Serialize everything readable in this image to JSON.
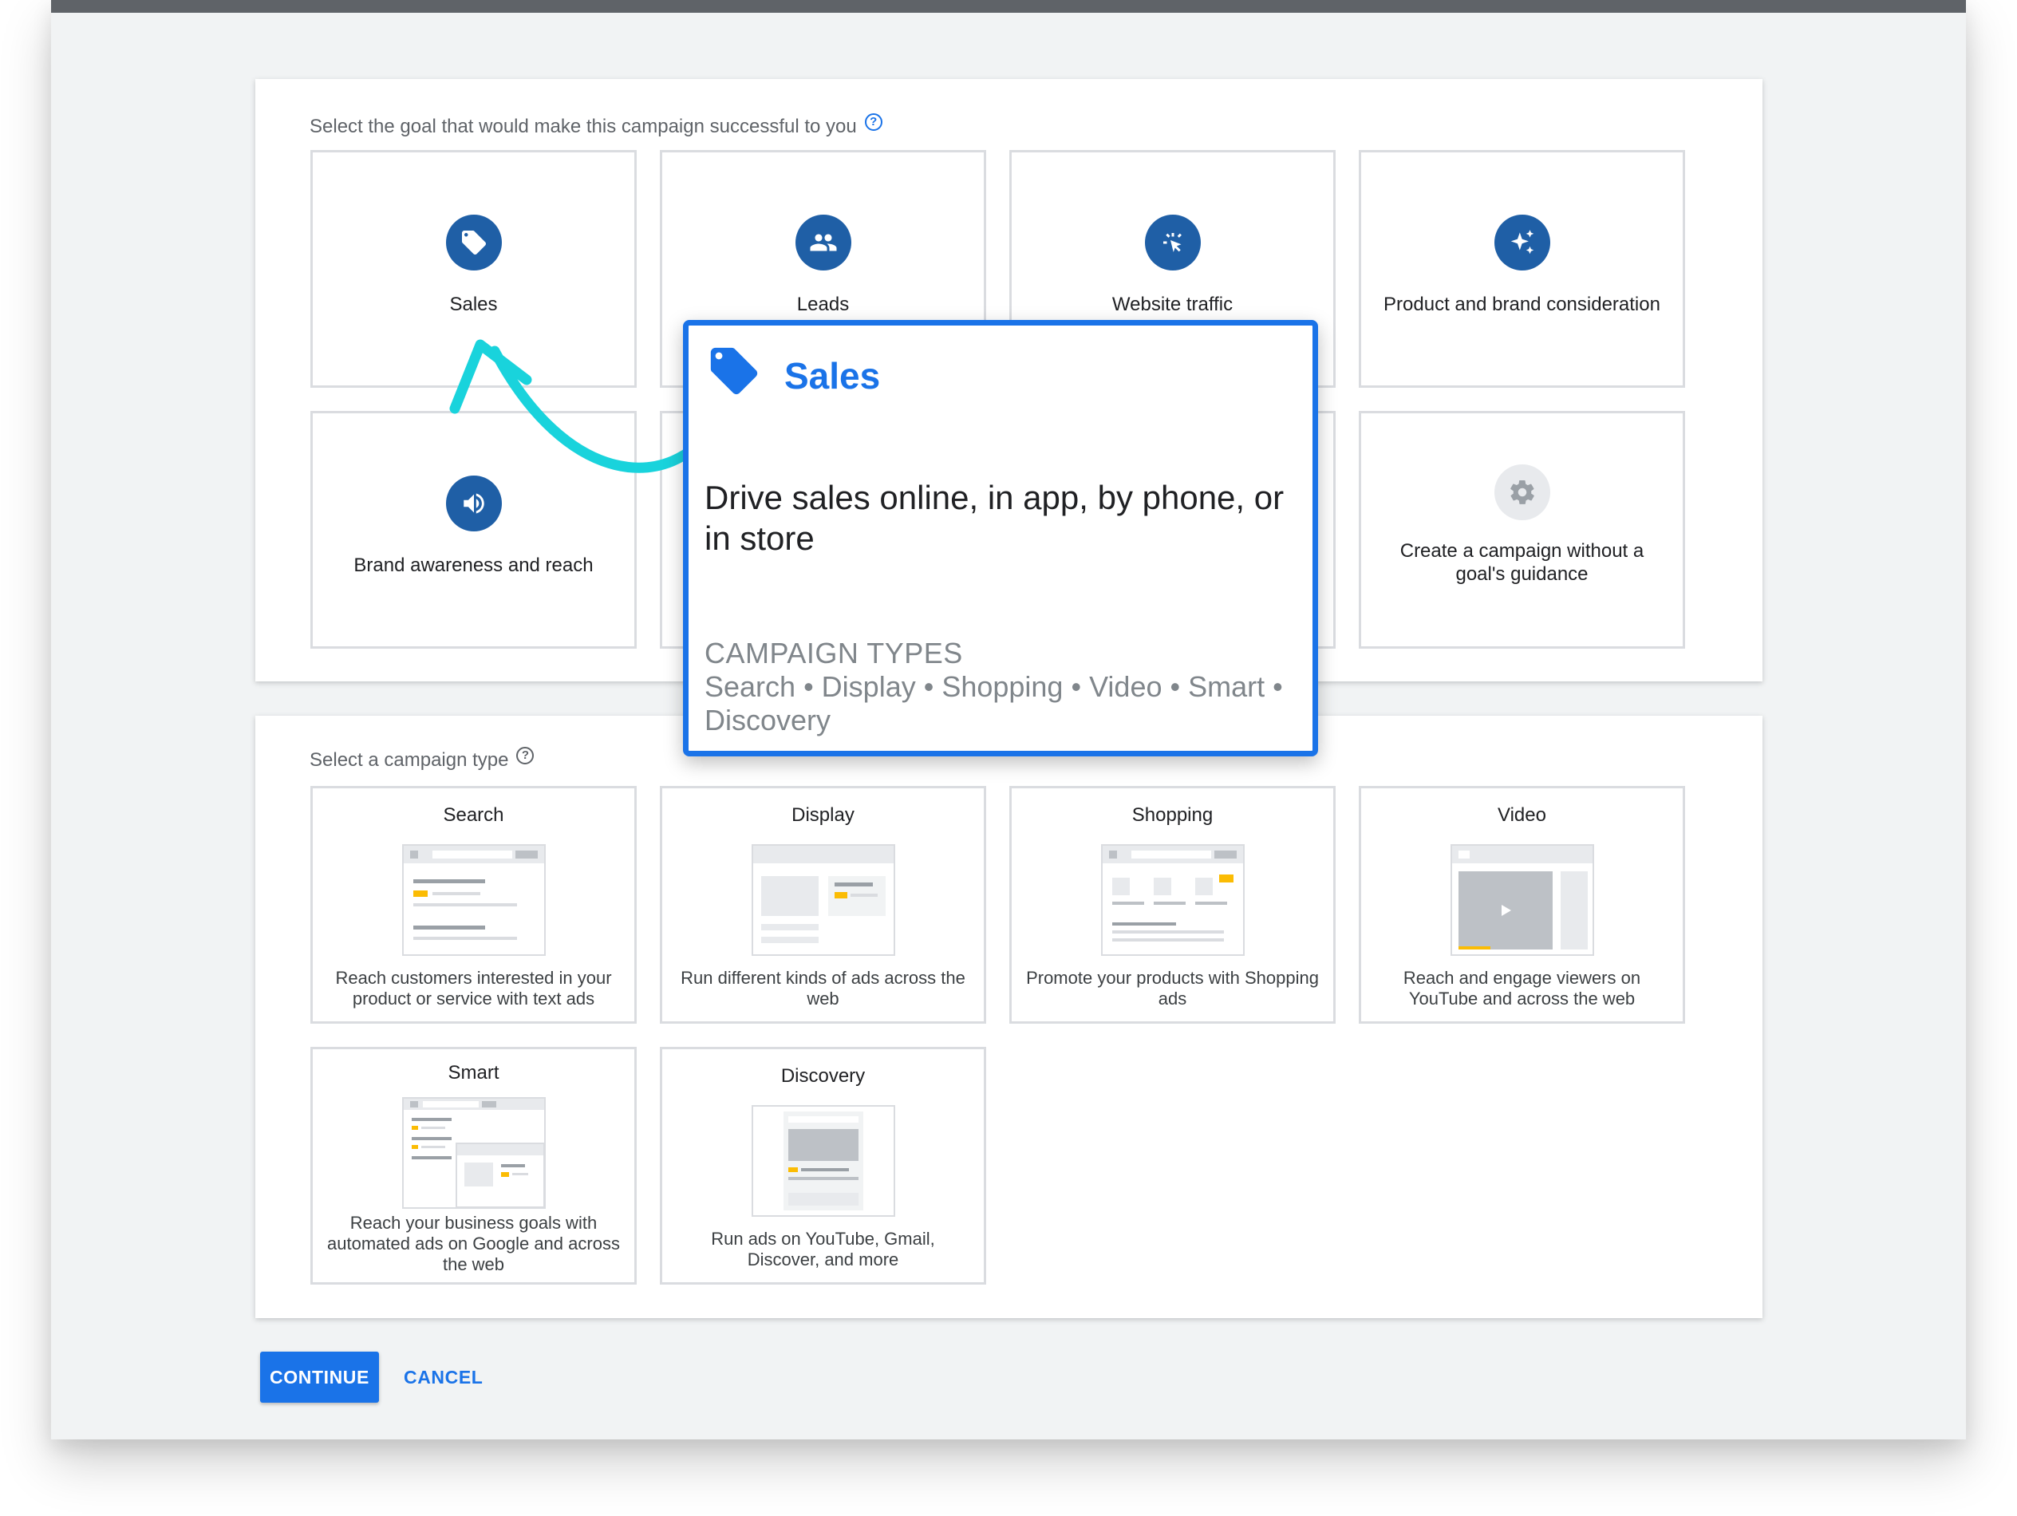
{
  "goals_section": {
    "label": "Select the goal that would make this campaign successful to you",
    "help": "?",
    "cards": [
      {
        "title": "Sales",
        "icon": "tag-icon"
      },
      {
        "title": "Leads",
        "icon": "people-icon"
      },
      {
        "title": "Website traffic",
        "icon": "cursor-click-icon"
      },
      {
        "title": "Product and brand consideration",
        "icon": "sparkle-icon"
      },
      {
        "title": "Brand awareness and reach",
        "icon": "megaphone-icon"
      },
      {
        "title": "Create a campaign without a goal's guidance",
        "icon": "gear-icon"
      }
    ]
  },
  "popup": {
    "title": "Sales",
    "description": "Drive sales online, in app, by phone, or in store",
    "types_label": "CAMPAIGN TYPES",
    "types": "Search • Display • Shopping • Video • Smart • Discovery"
  },
  "types_section": {
    "label": "Select a campaign type",
    "help": "?",
    "cards": [
      {
        "title": "Search",
        "description": "Reach customers interested in your product or service with text ads"
      },
      {
        "title": "Display",
        "description": "Run different kinds of ads across the web"
      },
      {
        "title": "Shopping",
        "description": "Promote your products with Shopping ads"
      },
      {
        "title": "Video",
        "description": "Reach and engage viewers on YouTube and across the web"
      },
      {
        "title": "Smart",
        "description": "Reach your business goals with automated ads on Google and across the web"
      },
      {
        "title": "Discovery",
        "description": "Run ads on YouTube, Gmail, Discover, and more"
      }
    ]
  },
  "actions": {
    "continue": "CONTINUE",
    "cancel": "CANCEL"
  },
  "colors": {
    "accent": "#1a73e8",
    "goal_icon_bg": "#1f5fa6",
    "arrow": "#19d3dc",
    "illustration_yellow": "#fbbc04"
  }
}
